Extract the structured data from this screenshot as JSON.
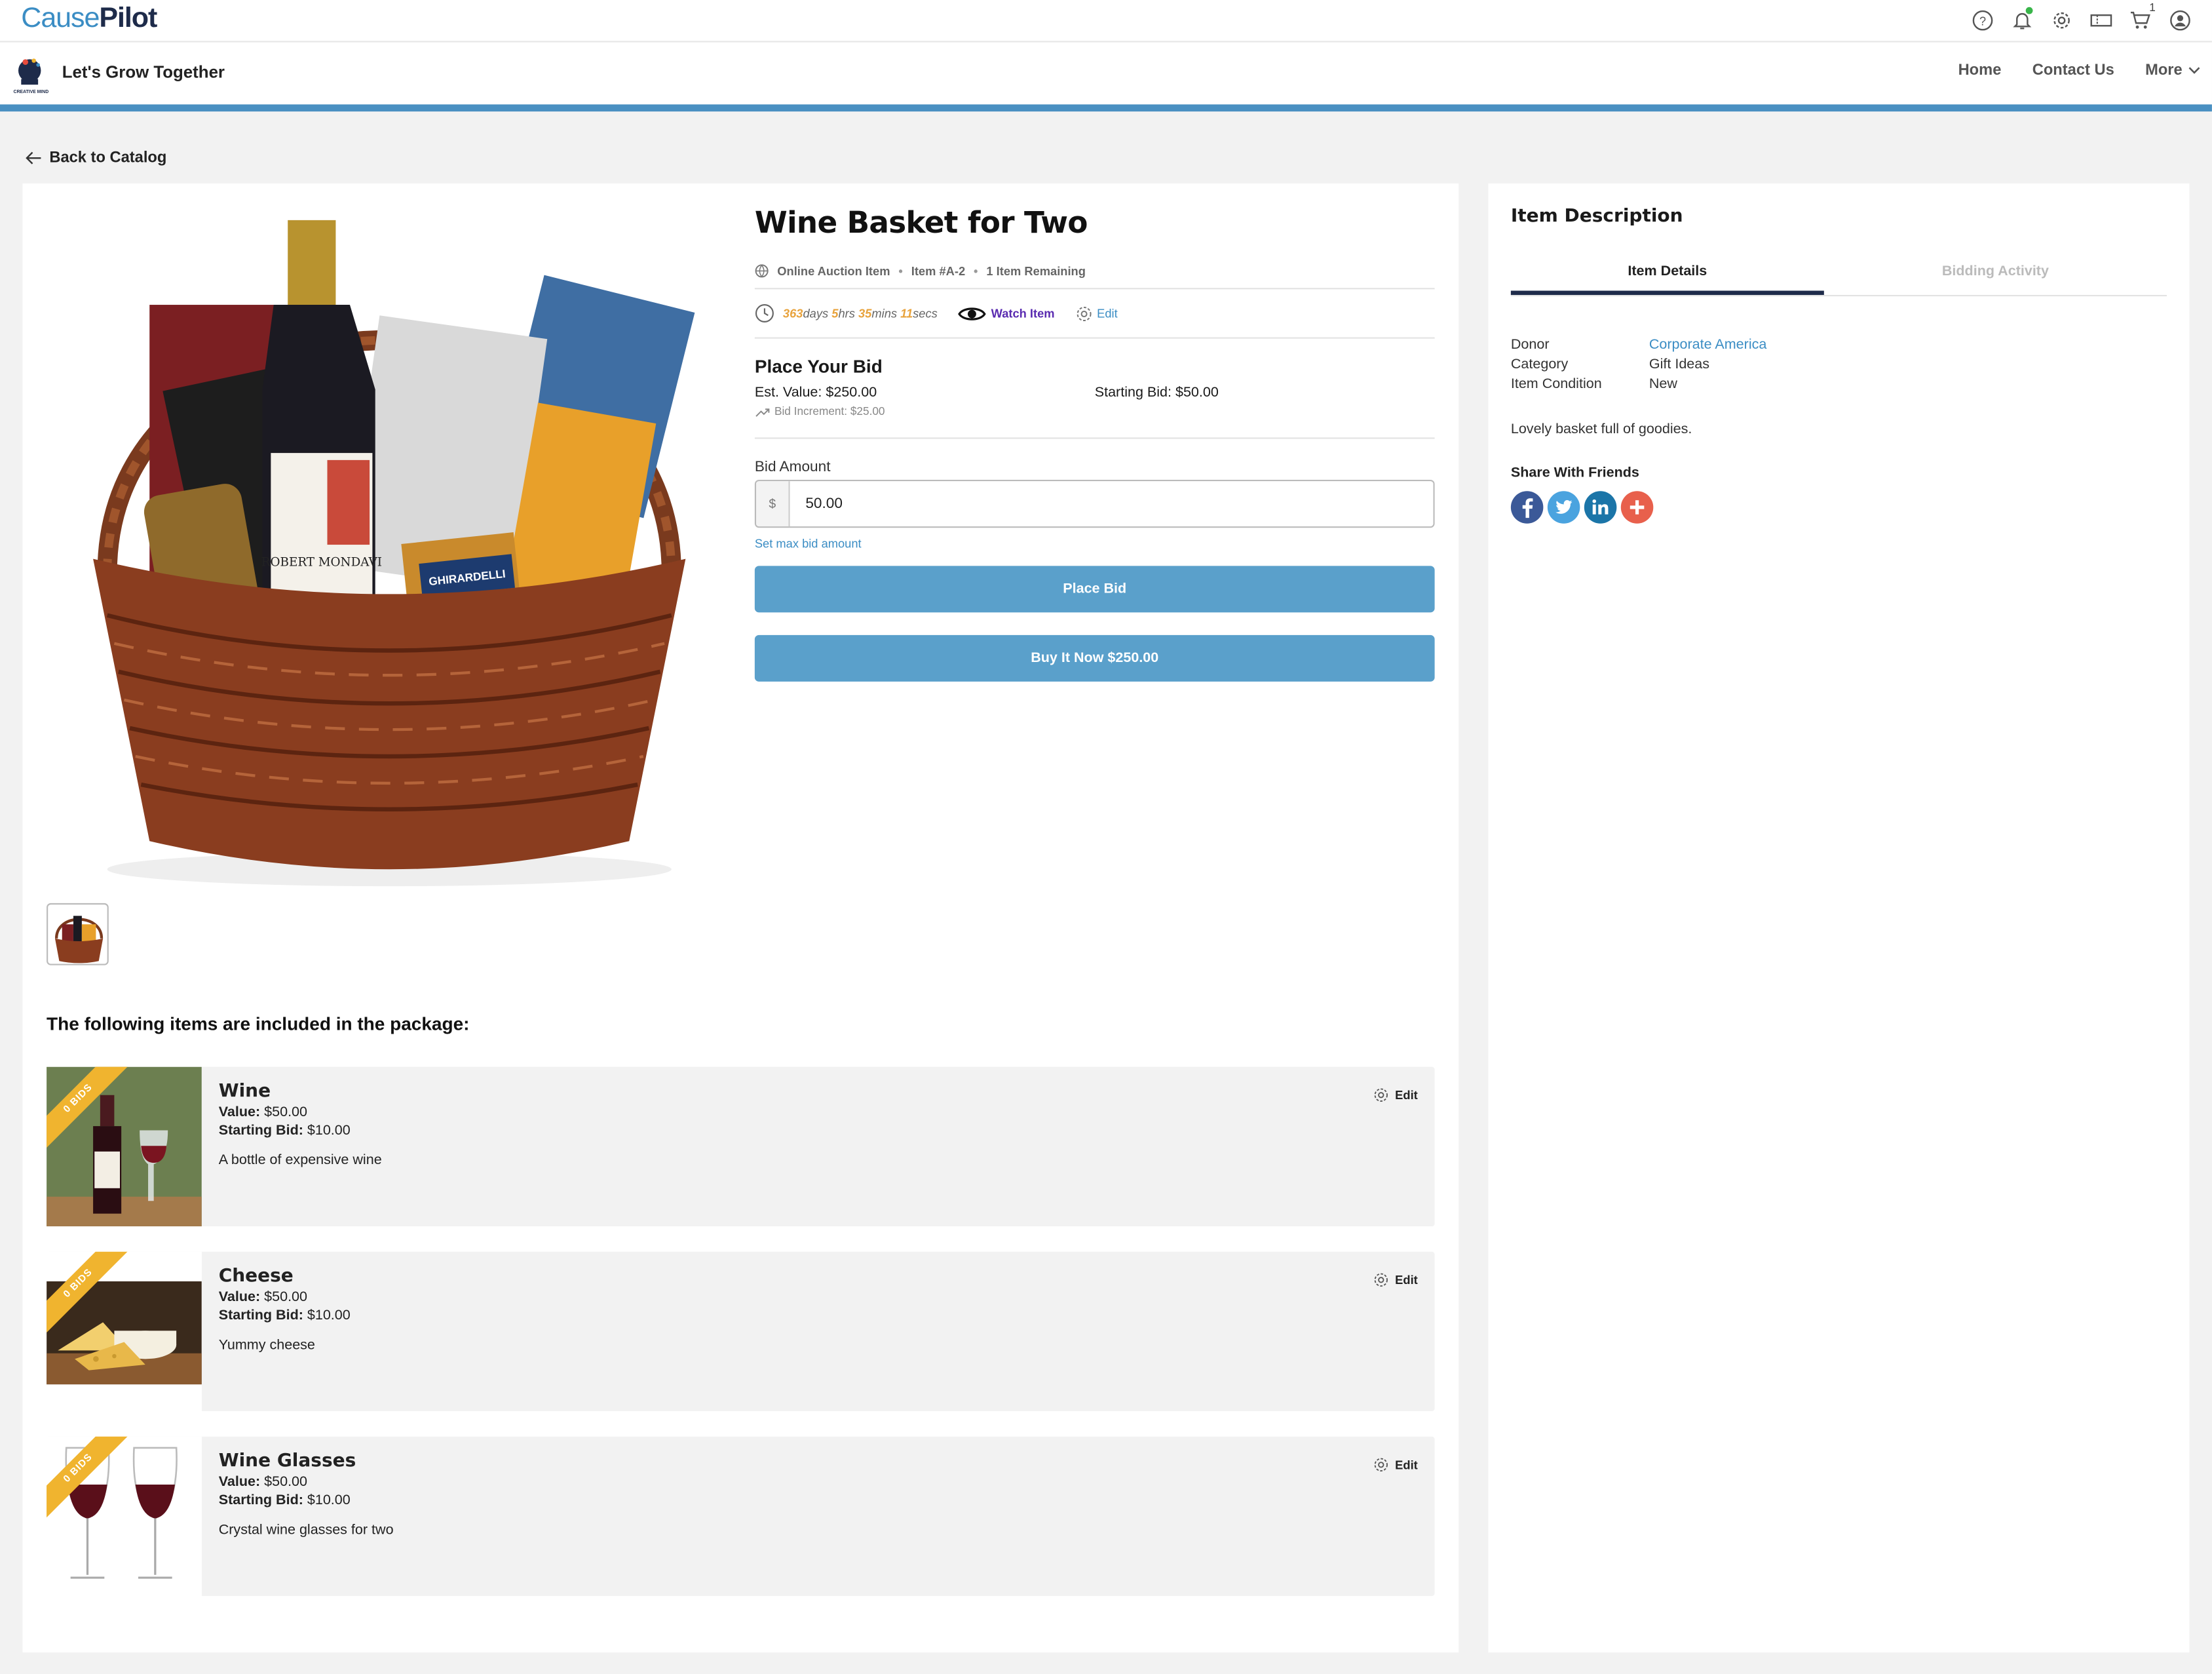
{
  "brand": {
    "part1": "Cause",
    "part2": "Pilot"
  },
  "top_icons": [
    "help-icon",
    "bell-icon",
    "gear-icon",
    "ticket-icon",
    "cart-icon",
    "user-icon"
  ],
  "cart_count": "1",
  "org": {
    "name": "Let's Grow Together",
    "logo_caption": "CREATIVE MIND"
  },
  "nav": {
    "home": "Home",
    "contact": "Contact Us",
    "more": "More"
  },
  "back_label": "Back to Catalog",
  "item": {
    "title": "Wine Basket for Two",
    "type": "Online Auction Item",
    "number": "Item #A-2",
    "remaining": "1 Item Remaining",
    "timer": {
      "days": "363",
      "days_u": "days",
      "hrs": "5",
      "hrs_u": "hrs",
      "mins": "35",
      "mins_u": "mins",
      "secs": "11",
      "secs_u": "secs"
    },
    "watch_label": "Watch Item",
    "edit_label": "Edit",
    "bid_heading": "Place Your Bid",
    "est_value": "Est. Value: $250.00",
    "starting_bid": "Starting Bid: $50.00",
    "increment": "Bid Increment: $25.00",
    "bid_amount_label": "Bid Amount",
    "currency": "$",
    "bid_value": "50.00",
    "max_bid_link": "Set max bid amount",
    "place_bid": "Place Bid",
    "buy_now": "Buy It Now $250.00"
  },
  "package_title": "The following items are included in the package:",
  "package_items": [
    {
      "name": "Wine",
      "value_label": "Value:",
      "value": " $50.00",
      "start_label": "Starting Bid:",
      "start": " $10.00",
      "desc": "A bottle of expensive wine",
      "bids": "0 BIDS",
      "edit": "Edit"
    },
    {
      "name": "Cheese",
      "value_label": "Value:",
      "value": " $50.00",
      "start_label": "Starting Bid:",
      "start": " $10.00",
      "desc": "Yummy cheese",
      "bids": "0 BIDS",
      "edit": "Edit"
    },
    {
      "name": "Wine Glasses",
      "value_label": "Value:",
      "value": " $50.00",
      "start_label": "Starting Bid:",
      "start": " $10.00",
      "desc": "Crystal wine glasses for two",
      "bids": "0 BIDS",
      "edit": "Edit"
    }
  ],
  "side": {
    "title": "Item Description",
    "tab_details": "Item Details",
    "tab_activity": "Bidding Activity",
    "donor_k": "Donor",
    "donor_v": "Corporate America",
    "category_k": "Category",
    "category_v": "Gift Ideas",
    "condition_k": "Item Condition",
    "condition_v": "New",
    "description": "Lovely basket full of goodies.",
    "share": "Share With Friends"
  },
  "colors": {
    "accent": "#4a90c2",
    "button": "#5aa0cb",
    "ribbon": "#f0b42f",
    "timer": "#e8a33d",
    "watch": "#5a2bb0"
  }
}
